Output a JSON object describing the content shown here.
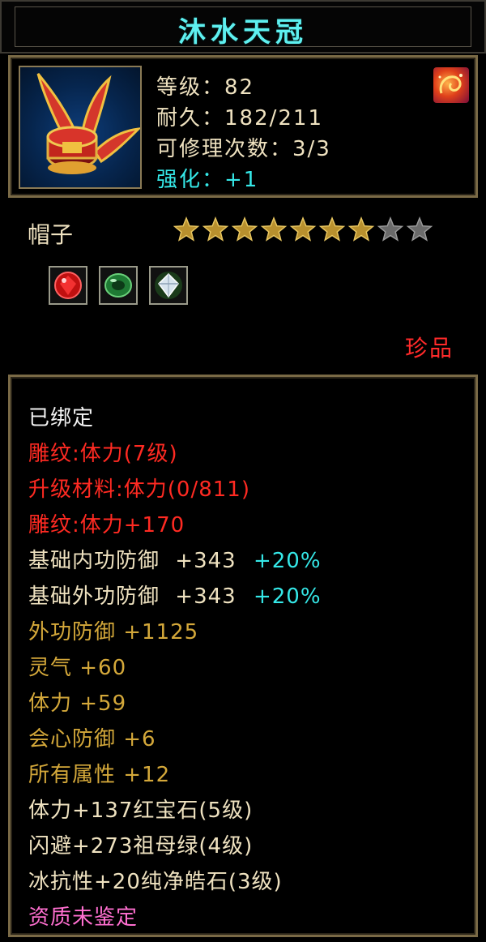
{
  "item": {
    "name": "沐水天冠",
    "level_line": "等级：82",
    "durability_line": "耐久：182/211",
    "repair_line": "可修理次数：3/3",
    "enhance_label": "强化",
    "enhance_value": "：+1",
    "type": "帽子",
    "stars": {
      "filled": 7,
      "total": 9
    },
    "rarity": "珍品",
    "gems": [
      "ruby-gem-icon",
      "emerald-ring-icon",
      "diamond-gem-icon"
    ]
  },
  "attributes": {
    "bound": "已绑定",
    "engrave1": "雕纹:体力(7级)",
    "upgrade": "升级材料:体力(0/811)",
    "engrave2": "雕纹:体力+170",
    "base_inner_def": {
      "label": "基础内功防御",
      "value": "+343",
      "bonus": "+20%"
    },
    "base_outer_def": {
      "label": "基础外功防御",
      "value": "+343",
      "bonus": "+20%"
    },
    "outer_def": "外功防御 +1125",
    "spirit": "灵气 +60",
    "stamina": "体力 +59",
    "crit_def": "会心防御 +6",
    "all_attr": "所有属性 +12",
    "gem1": "体力+137红宝石(5级)",
    "gem2": "闪避+273祖母绿(4级)",
    "gem3": "冰抗性+20纯净皓石(3级)",
    "quality": "资质未鉴定"
  },
  "colors": {
    "title": "#5ef0f0",
    "red": "#ff2a22",
    "gold": "#d4a83a",
    "cyan": "#35e8e8",
    "pink": "#ff6fd0",
    "border": "#7a6a46"
  }
}
